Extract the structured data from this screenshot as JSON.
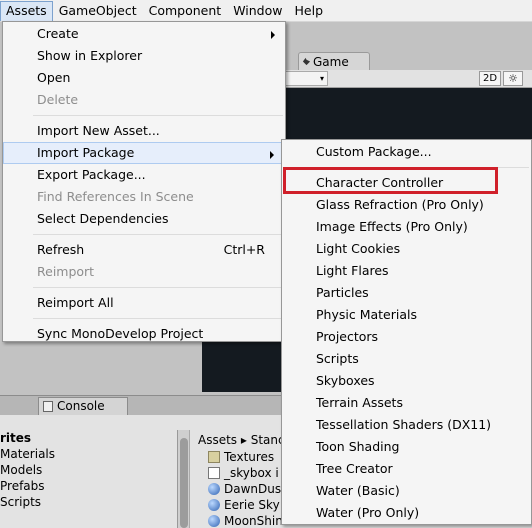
{
  "menubar": {
    "items": [
      {
        "label": "Assets"
      },
      {
        "label": "GameObject"
      },
      {
        "label": "Component"
      },
      {
        "label": "Window"
      },
      {
        "label": "Help"
      }
    ]
  },
  "assets_menu": {
    "items": [
      {
        "label": "Create",
        "has_submenu": true
      },
      {
        "label": "Show in Explorer"
      },
      {
        "label": "Open"
      },
      {
        "label": "Delete",
        "disabled": true
      },
      {
        "separator": true
      },
      {
        "label": "Import New Asset..."
      },
      {
        "label": "Import Package",
        "has_submenu": true,
        "highlighted": true
      },
      {
        "label": "Export Package..."
      },
      {
        "label": "Find References In Scene",
        "disabled": true
      },
      {
        "label": "Select Dependencies"
      },
      {
        "separator": true
      },
      {
        "label": "Refresh",
        "shortcut": "Ctrl+R"
      },
      {
        "label": "Reimport",
        "disabled": true
      },
      {
        "separator": true
      },
      {
        "label": "Reimport All"
      },
      {
        "separator": true
      },
      {
        "label": "Sync MonoDevelop Project"
      }
    ]
  },
  "package_menu": {
    "items": [
      {
        "label": "Custom Package..."
      },
      {
        "separator": true
      },
      {
        "label": "Character Controller",
        "boxed": true
      },
      {
        "label": "Glass Refraction (Pro Only)"
      },
      {
        "label": "Image Effects (Pro Only)"
      },
      {
        "label": "Light Cookies"
      },
      {
        "label": "Light Flares"
      },
      {
        "label": "Particles"
      },
      {
        "label": "Physic Materials"
      },
      {
        "label": "Projectors"
      },
      {
        "label": "Scripts"
      },
      {
        "label": "Skyboxes"
      },
      {
        "label": "Terrain Assets"
      },
      {
        "label": "Tessellation Shaders (DX11)"
      },
      {
        "label": "Toon Shading"
      },
      {
        "label": "Tree Creator"
      },
      {
        "label": "Water (Basic)"
      },
      {
        "label": "Water (Pro Only)"
      }
    ],
    "box_color": "#d0202a"
  },
  "background": {
    "game_tab": "Game",
    "toolbar_2d": "2D",
    "console_tab": "Console",
    "project_left": [
      {
        "label": "rites",
        "bold": true
      },
      {
        "label": "Materials"
      },
      {
        "label": "Models"
      },
      {
        "label": "Prefabs"
      },
      {
        "label": "Scripts"
      }
    ],
    "breadcrumb": "Assets ▸ Stanc",
    "files": [
      {
        "label": "Textures",
        "icon": "folder-icon"
      },
      {
        "label": "_skybox i",
        "icon": "document-icon"
      },
      {
        "label": "DawnDus",
        "icon": "sphere-icon"
      },
      {
        "label": "Eerie Sky",
        "icon": "sphere-icon"
      },
      {
        "label": "MoonShin",
        "icon": "sphere-icon"
      }
    ]
  },
  "colors": {
    "menu_highlight": "#e6eefb",
    "menubar_active": "#dbe7f6",
    "annotation_red": "#d0202a"
  }
}
